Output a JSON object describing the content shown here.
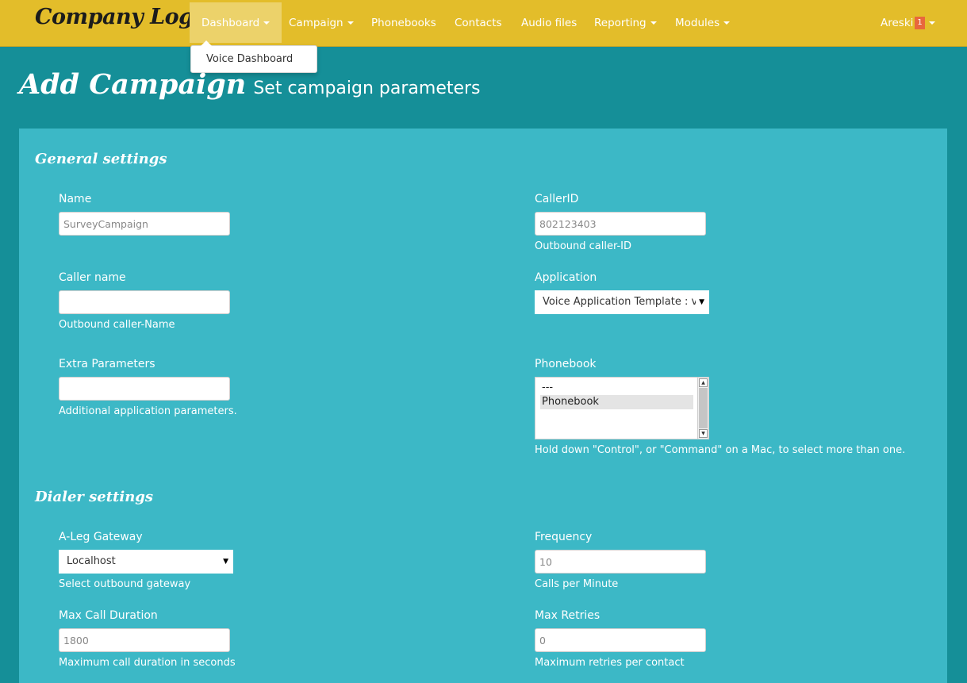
{
  "navbar": {
    "brand": "Company Logo",
    "items": [
      {
        "label": "Dashboard",
        "dropdown": true,
        "active": true
      },
      {
        "label": "Campaign",
        "dropdown": true
      },
      {
        "label": "Phonebooks"
      },
      {
        "label": "Contacts"
      },
      {
        "label": "Audio files"
      },
      {
        "label": "Reporting",
        "dropdown": true
      },
      {
        "label": "Modules",
        "dropdown": true
      }
    ],
    "user": {
      "name": "Areski",
      "badge": "1"
    },
    "dropdown_menu": {
      "items": [
        "Voice Dashboard"
      ]
    }
  },
  "page": {
    "title": "Add Campaign",
    "subtitle": "Set campaign parameters"
  },
  "general": {
    "title": "General settings",
    "name": {
      "label": "Name",
      "value": "SurveyCampaign"
    },
    "callerid": {
      "label": "CallerID",
      "value": "802123403",
      "help": "Outbound caller-ID"
    },
    "caller_name": {
      "label": "Caller name",
      "value": "",
      "help": "Outbound caller-Name"
    },
    "application": {
      "label": "Application",
      "value": "Voice Application Template : vo"
    },
    "extra": {
      "label": "Extra Parameters",
      "value": "",
      "help": "Additional application parameters."
    },
    "phonebook": {
      "label": "Phonebook",
      "options": [
        "---",
        "Phonebook"
      ],
      "help": "Hold down \"Control\", or \"Command\" on a Mac, to select more than one."
    }
  },
  "dialer": {
    "title": "Dialer settings",
    "gateway": {
      "label": "A-Leg Gateway",
      "value": "Localhost",
      "help": "Select outbound gateway"
    },
    "frequency": {
      "label": "Frequency",
      "value": "10",
      "help": "Calls per Minute"
    },
    "max_duration": {
      "label": "Max Call Duration",
      "value": "1800",
      "help": "Maximum call duration in seconds"
    },
    "max_retries": {
      "label": "Max Retries",
      "value": "0",
      "help": "Maximum retries per contact"
    }
  },
  "colors": {
    "navbar": "#e3bd2a",
    "background": "#158f98",
    "panel": "#3cb8c6",
    "badge": "#e8673c"
  }
}
